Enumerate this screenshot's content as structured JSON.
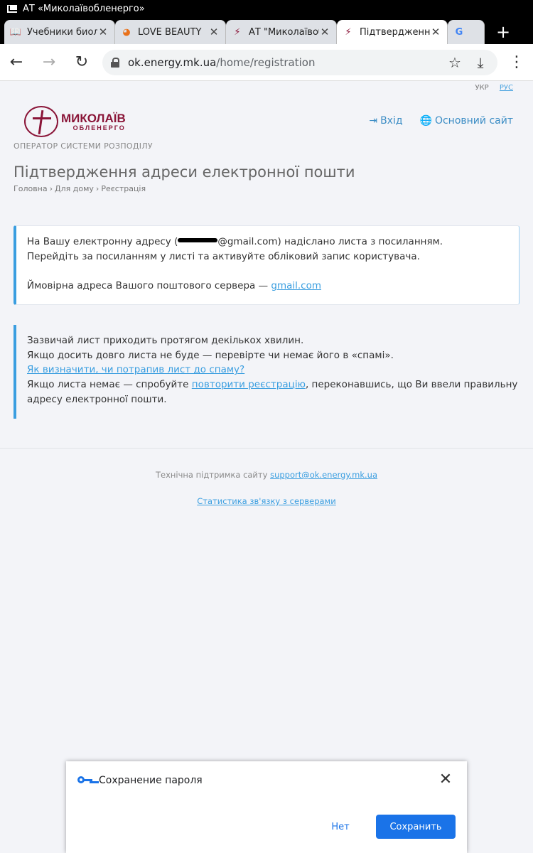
{
  "statusbar": {
    "title": "АТ «Миколаївобленерго»"
  },
  "tabs": [
    {
      "label": "Учебники биоло",
      "icon": "book-icon",
      "active": false
    },
    {
      "label": "LOVE BEAUTY",
      "icon": "leaf-icon",
      "active": false
    },
    {
      "label": "АТ \"Миколаївоб",
      "icon": "tower-icon",
      "active": false
    },
    {
      "label": "Підтвердження",
      "icon": "tower-icon",
      "active": true
    },
    {
      "label": "",
      "icon": "google-icon",
      "active": false
    }
  ],
  "toolbar": {
    "url_host": "ok.energy.mk.ua",
    "url_path": "/home/registration"
  },
  "page": {
    "lang_ukr": "УКР",
    "lang_rus": "РУС",
    "logo_word1": "МИКОЛАЇВ",
    "logo_word2": "ОБЛЕНЕРГО",
    "nav_login": "Вхід",
    "nav_main_site": "Основний сайт",
    "operator": "ОПЕРАТОР СИСТЕМИ РОЗПОДІЛУ",
    "title": "Підтвердження адреси електронної пошти",
    "breadcrumb": [
      "Головна",
      "Для дому",
      "Реєстрація"
    ],
    "notice1": {
      "line1_before": "На Вашу електронну адресу (",
      "line1_after": "@gmail.com) надіслано листа з посиланням.",
      "line2": "Перейдіть за посиланням у листі та активуйте обліковий запис користувача.",
      "line3_text": "Ймовірна адреса Вашого поштового сервера —",
      "line3_link": "gmail.com"
    },
    "notice2": {
      "line1": "Зазвичай лист приходить протягом декількох хвилин.",
      "line2": "Якщо досить довго листа не буде — перевірте чи немає його в «спамі».",
      "link_spam": "Як визначити, чи потрапив лист до спаму?",
      "line4_before": "Якщо листа немає — спробуйте",
      "link_retry": "повторити реєстрацію",
      "line4_after": ", переконавшись, що Ви ввели правильну",
      "line5": "адресу електронної пошти."
    },
    "footer_support_text": "Технічна підтримка сайту",
    "footer_support_email": "support@ok.energy.mk.ua",
    "footer_stats_link": "Статистика зв'язку з серверами"
  },
  "password_sheet": {
    "title": "Сохранение пароля",
    "no_label": "Нет",
    "save_label": "Сохранить"
  },
  "colors": {
    "brand": "#8a1538",
    "link": "#3a9ee0",
    "accent": "#1a73e8"
  }
}
